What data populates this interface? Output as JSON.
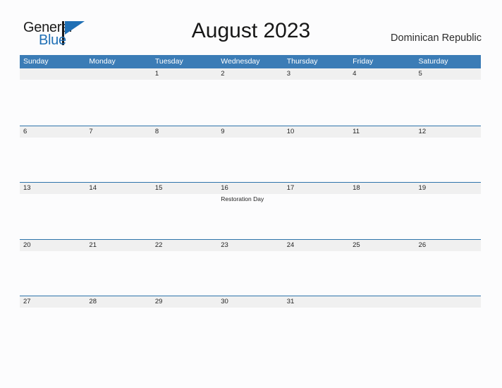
{
  "logo": {
    "word_one": "General",
    "word_two": "Blue",
    "triangle_icon": "blue-triangle-flag-icon",
    "color_dark": "#1b1b1b",
    "color_blue": "#1f6fb5"
  },
  "header": {
    "title": "August 2023",
    "country": "Dominican Republic"
  },
  "theme": {
    "header_bar_color": "#3b7cb6",
    "row_divider_color": "#2e74ab",
    "band_color": "#f0f0f0",
    "page_background": "#fcfcfd",
    "text_color": "#242424"
  },
  "calendar": {
    "weekdays": [
      "Sunday",
      "Monday",
      "Tuesday",
      "Wednesday",
      "Thursday",
      "Friday",
      "Saturday"
    ],
    "weeks": [
      [
        {
          "date": "",
          "events": []
        },
        {
          "date": "",
          "events": []
        },
        {
          "date": "1",
          "events": []
        },
        {
          "date": "2",
          "events": []
        },
        {
          "date": "3",
          "events": []
        },
        {
          "date": "4",
          "events": []
        },
        {
          "date": "5",
          "events": []
        }
      ],
      [
        {
          "date": "6",
          "events": []
        },
        {
          "date": "7",
          "events": []
        },
        {
          "date": "8",
          "events": []
        },
        {
          "date": "9",
          "events": []
        },
        {
          "date": "10",
          "events": []
        },
        {
          "date": "11",
          "events": []
        },
        {
          "date": "12",
          "events": []
        }
      ],
      [
        {
          "date": "13",
          "events": []
        },
        {
          "date": "14",
          "events": []
        },
        {
          "date": "15",
          "events": []
        },
        {
          "date": "16",
          "events": [
            "Restoration Day"
          ]
        },
        {
          "date": "17",
          "events": []
        },
        {
          "date": "18",
          "events": []
        },
        {
          "date": "19",
          "events": []
        }
      ],
      [
        {
          "date": "20",
          "events": []
        },
        {
          "date": "21",
          "events": []
        },
        {
          "date": "22",
          "events": []
        },
        {
          "date": "23",
          "events": []
        },
        {
          "date": "24",
          "events": []
        },
        {
          "date": "25",
          "events": []
        },
        {
          "date": "26",
          "events": []
        }
      ],
      [
        {
          "date": "27",
          "events": []
        },
        {
          "date": "28",
          "events": []
        },
        {
          "date": "29",
          "events": []
        },
        {
          "date": "30",
          "events": []
        },
        {
          "date": "31",
          "events": []
        },
        {
          "date": "",
          "events": []
        },
        {
          "date": "",
          "events": []
        }
      ]
    ]
  }
}
